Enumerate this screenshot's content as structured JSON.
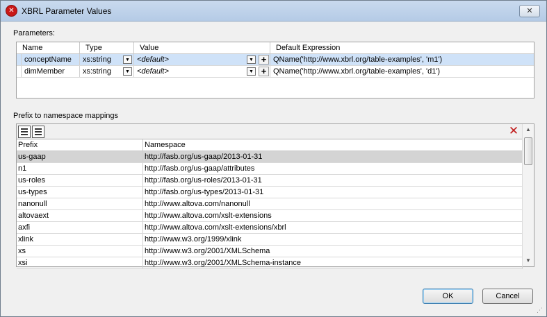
{
  "window": {
    "title": "XBRL Parameter Values",
    "close_glyph": "✕",
    "app_icon": "altova-xmlspy-icon"
  },
  "parameters": {
    "section_label": "Parameters:",
    "columns": [
      "Name",
      "Type",
      "Value",
      "Default Expression"
    ],
    "rows": [
      {
        "name": "conceptName",
        "type": "xs:string",
        "value": "<default>",
        "default_expression": "QName('http://www.xbrl.org/table-examples', 'm1')"
      },
      {
        "name": "dimMember",
        "type": "xs:string",
        "value": "<default>",
        "default_expression": "QName('http://www.xbrl.org/table-examples', 'd1')"
      }
    ],
    "plus_glyph": "+"
  },
  "namespaces": {
    "section_label": "Prefix to namespace mappings",
    "columns": [
      "Prefix",
      "Namespace"
    ],
    "rows": [
      {
        "prefix": "us-gaap",
        "namespace": "http://fasb.org/us-gaap/2013-01-31"
      },
      {
        "prefix": "n1",
        "namespace": "http://fasb.org/us-gaap/attributes"
      },
      {
        "prefix": "us-roles",
        "namespace": "http://fasb.org/us-roles/2013-01-31"
      },
      {
        "prefix": "us-types",
        "namespace": "http://fasb.org/us-types/2013-01-31"
      },
      {
        "prefix": "nanonull",
        "namespace": "http://www.altova.com/nanonull"
      },
      {
        "prefix": "altovaext",
        "namespace": "http://www.altova.com/xslt-extensions"
      },
      {
        "prefix": "axfi",
        "namespace": "http://www.altova.com/xslt-extensions/xbrl"
      },
      {
        "prefix": "xlink",
        "namespace": "http://www.w3.org/1999/xlink"
      },
      {
        "prefix": "xs",
        "namespace": "http://www.w3.org/2001/XMLSchema"
      },
      {
        "prefix": "xsi",
        "namespace": "http://www.w3.org/2001/XMLSchema-instance"
      }
    ],
    "delete_glyph": "✕"
  },
  "buttons": {
    "ok": "OK",
    "cancel": "Cancel"
  },
  "colors": {
    "selection": "#cfe2f8",
    "delete_icon": "#c11a1a",
    "title_icon": "#c91818"
  }
}
